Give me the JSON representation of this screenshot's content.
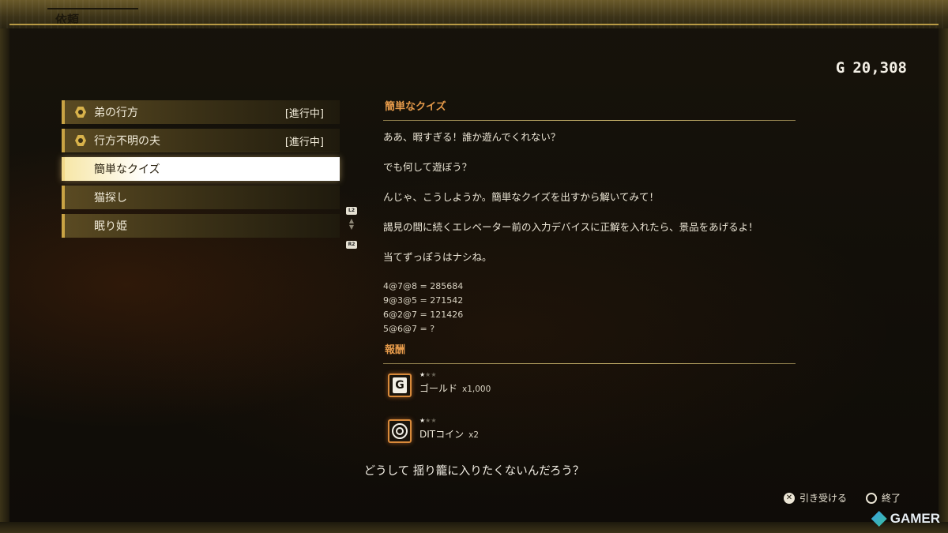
{
  "header": {
    "title": "依頼"
  },
  "wallet": {
    "currency": "G",
    "amount": "20,308"
  },
  "requests": [
    {
      "label": "弟の行方",
      "status": "[進行中]",
      "has_marker": true
    },
    {
      "label": "行方不明の夫",
      "status": "[進行中]",
      "has_marker": true
    },
    {
      "label": "簡単なクイズ",
      "status": "",
      "has_marker": false,
      "selected": true
    },
    {
      "label": "猫探し",
      "status": "",
      "has_marker": false
    },
    {
      "label": "眠り姫",
      "status": "",
      "has_marker": false
    }
  ],
  "scroll": {
    "up_button": "L2",
    "down_button": "R2"
  },
  "detail": {
    "title": "簡単なクイズ",
    "paragraphs": [
      "ああ、暇すぎる！誰か遊んでくれない？",
      "でも何して遊ぼう？",
      "んじゃ、こうしようか。簡単なクイズを出すから解いてみて！",
      "謁見の間に続くエレベーター前の入力デバイスに正解を入れたら、景品をあげるよ！",
      "当てずっぽうはナシね。"
    ],
    "formulas": [
      "4@7@8 = 285684",
      "9@3@5 = 271542",
      "6@2@7 = 121426",
      "5@6@7 = ?"
    ]
  },
  "rewards": {
    "title": "報酬",
    "items": [
      {
        "icon": "gold-icon",
        "name": "ゴールド",
        "qty": "x1,000",
        "rarity": 1,
        "max_rarity": 3
      },
      {
        "icon": "dit-coin-icon",
        "name": "DITコイン",
        "qty": "x2",
        "rarity": 1,
        "max_rarity": 3
      }
    ]
  },
  "subtitle": "どうして 揺り籠に入りたくないんだろう？",
  "controls": {
    "accept": {
      "button": "✕",
      "label": "引き受ける"
    },
    "exit": {
      "button": "○",
      "label": "終了"
    }
  },
  "watermark": {
    "text": "GAMER"
  },
  "colors": {
    "accent": "#e59a4a",
    "frame": "#b89a45",
    "selected_bg": "#ffffff"
  }
}
